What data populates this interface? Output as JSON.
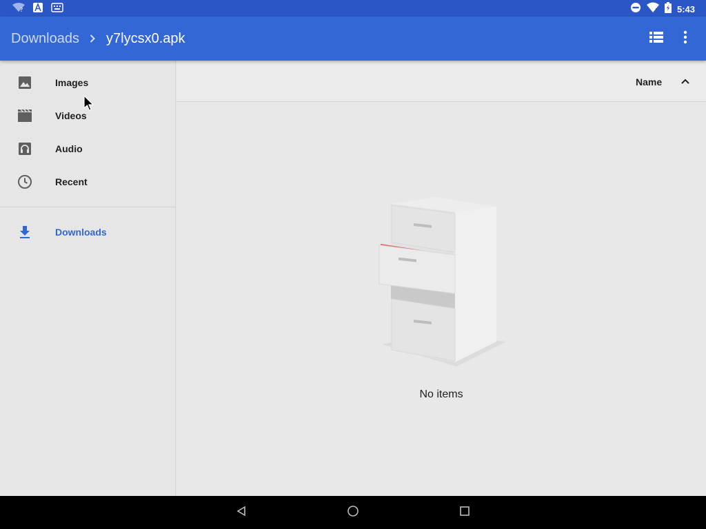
{
  "status_bar": {
    "time": "5:43",
    "icons_left": [
      "wifi-question-icon",
      "a-notification-icon",
      "keyboard-icon"
    ],
    "icons_right": [
      "do-not-disturb-icon",
      "wifi-icon",
      "battery-icon"
    ]
  },
  "app_bar": {
    "breadcrumb_root": "Downloads",
    "breadcrumb_current": "y7lycsx0.apk",
    "actions": [
      "list-view-icon",
      "more-options-icon"
    ]
  },
  "drawer": {
    "items": [
      {
        "label": "Images",
        "icon": "image-icon"
      },
      {
        "label": "Videos",
        "icon": "video-icon"
      },
      {
        "label": "Audio",
        "icon": "headphones-icon"
      },
      {
        "label": "Recent",
        "icon": "clock-icon"
      }
    ],
    "roots": [
      {
        "label": "Downloads",
        "icon": "download-icon",
        "active": true
      }
    ]
  },
  "content": {
    "sort_label": "Name",
    "sort_direction": "ascending",
    "empty_message": "No items"
  },
  "colors": {
    "status_bar": "#2a56c6",
    "app_bar": "#3367d6",
    "accent": "#3367d6",
    "background": "#e6e6e6"
  }
}
